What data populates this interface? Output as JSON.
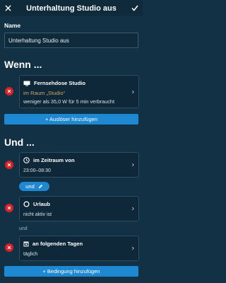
{
  "header": {
    "title": "Unterhaltung Studio aus"
  },
  "name_section": {
    "label": "Name",
    "value": "Unterhaltung Studio aus"
  },
  "wenn": {
    "heading": "Wenn ...",
    "trigger": {
      "device": "Fernsehdose Studio",
      "room": "im Raum „Studio“",
      "condition": "weniger als 35,0 W für 5 min verbraucht"
    },
    "add_button": "+ Auslöser hinzufügen"
  },
  "und": {
    "heading": "Und ...",
    "conditions": [
      {
        "title": "im Zeitraum von",
        "detail": "23:00–08:30"
      },
      {
        "title": "Urlaub",
        "detail": "nicht aktiv ist"
      },
      {
        "title": "an folgenden Tagen",
        "detail": "täglich"
      }
    ],
    "pill_label": "und",
    "connector": "und",
    "add_button": "+ Bedingung hinzufügen"
  },
  "colors": {
    "background": "#123145",
    "accent": "#1e89d2",
    "remove": "#d92027"
  }
}
